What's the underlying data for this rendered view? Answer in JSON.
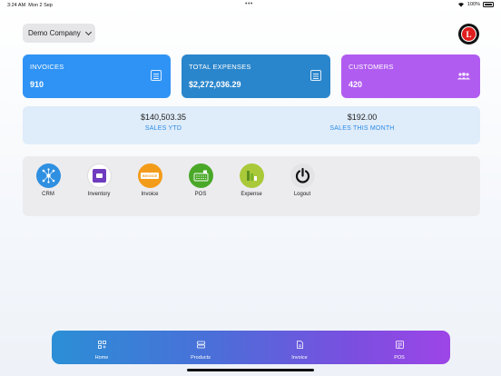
{
  "status_bar": {
    "time": "3:24 AM",
    "date": "Mon 2 Sep",
    "dots": "•••",
    "battery": "100%"
  },
  "header": {
    "company": "Demo Company",
    "profile_initial": "L"
  },
  "stats": [
    {
      "label": "INVOICES",
      "value": "910",
      "color": "#2f93f5"
    },
    {
      "label": "TOTAL EXPENSES",
      "value": "$2,272,036.29",
      "color": "#2a86cc"
    },
    {
      "label": "CUSTOMERS",
      "value": "420",
      "color": "#b15cf0"
    }
  ],
  "sales": {
    "ytd_amount": "$140,503.35",
    "ytd_label": "SALES YTD",
    "month_amount": "$192.00",
    "month_label": "SALES THIS MONTH"
  },
  "apps": [
    {
      "label": "CRM",
      "icon": "crm-icon"
    },
    {
      "label": "Inventory",
      "icon": "inventory-icon"
    },
    {
      "label": "Invoice",
      "icon": "invoice-icon",
      "badge": "INVOICE"
    },
    {
      "label": "POS",
      "icon": "pos-icon"
    },
    {
      "label": "Expense",
      "icon": "expense-icon"
    },
    {
      "label": "Logout",
      "icon": "power-icon"
    }
  ],
  "tabs": [
    {
      "label": "Home",
      "icon": "home-grid-icon"
    },
    {
      "label": "Products",
      "icon": "products-icon"
    },
    {
      "label": "Invoice",
      "icon": "document-icon"
    },
    {
      "label": "POS",
      "icon": "pos-tab-icon"
    }
  ]
}
